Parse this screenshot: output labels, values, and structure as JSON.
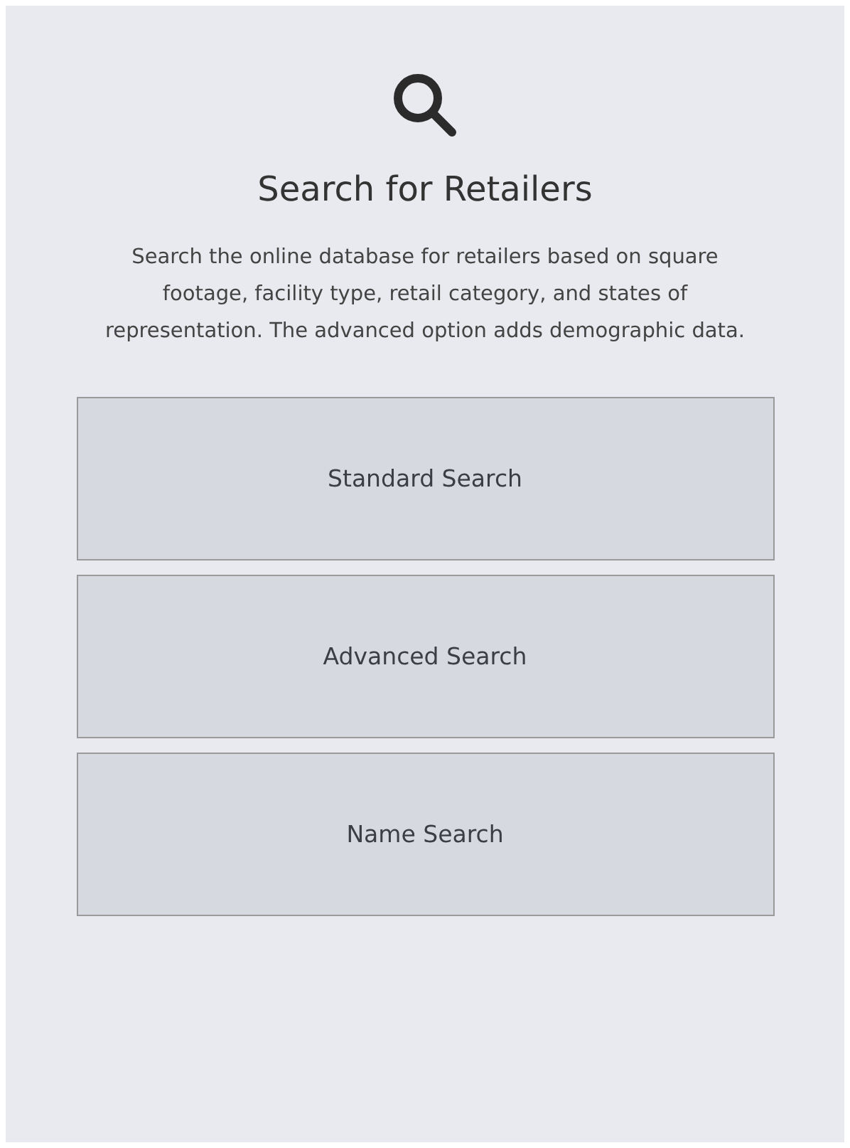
{
  "heading": "Search for Retailers",
  "description": "Search the online database for retailers based on square footage, facility type, retail category, and states of representation. The advanced option adds demographic data.",
  "buttons": [
    {
      "label": "Standard Search"
    },
    {
      "label": "Advanced Search"
    },
    {
      "label": "Name Search"
    }
  ]
}
